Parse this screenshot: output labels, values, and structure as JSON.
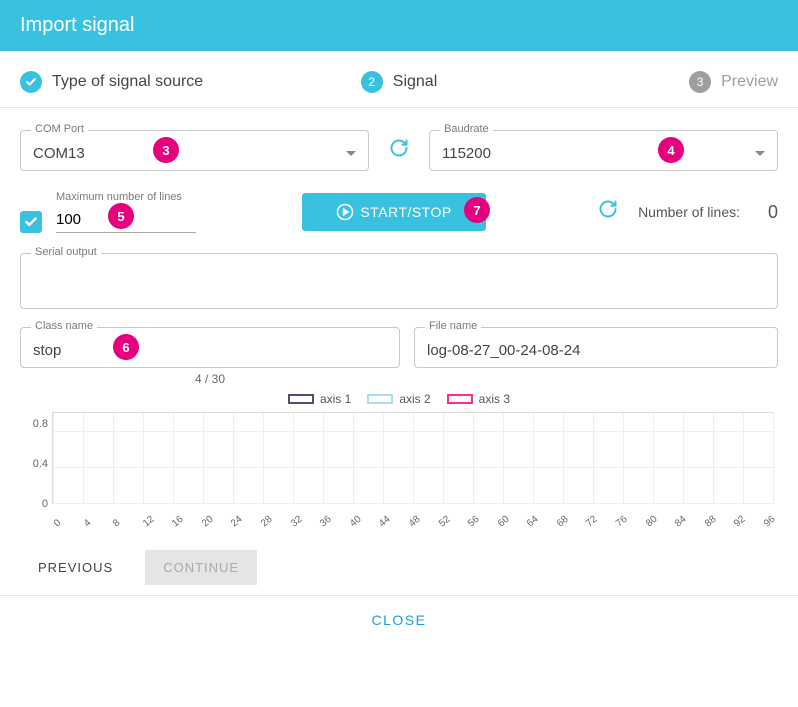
{
  "header": {
    "title": "Import signal"
  },
  "stepper": {
    "step1": {
      "label": "Type of signal source",
      "state": "done"
    },
    "step2": {
      "label": "Signal",
      "num": "2",
      "state": "active"
    },
    "step3": {
      "label": "Preview",
      "num": "3",
      "state": "future"
    }
  },
  "com_port": {
    "label": "COM Port",
    "value": "COM13"
  },
  "baudrate": {
    "label": "Baudrate",
    "value": "115200"
  },
  "max_lines": {
    "label": "Maximum number of lines",
    "value": "100"
  },
  "start_stop": {
    "label": "START/STOP"
  },
  "num_lines": {
    "label": "Number of lines:",
    "value": "0"
  },
  "serial_output": {
    "label": "Serial output"
  },
  "class_name": {
    "label": "Class name",
    "value": "stop",
    "counter": "4 / 30"
  },
  "file_name": {
    "label": "File name",
    "value": "log-08-27_00-24-08-24"
  },
  "chart_data": {
    "type": "line",
    "series": [
      {
        "name": "axis 1",
        "color": "#5a4a7a",
        "values": []
      },
      {
        "name": "axis 2",
        "color": "#a8dff2",
        "values": []
      },
      {
        "name": "axis 3",
        "color": "#ff2e88",
        "values": []
      }
    ],
    "x": [
      0,
      4,
      8,
      12,
      16,
      20,
      24,
      28,
      32,
      36,
      40,
      44,
      48,
      52,
      56,
      60,
      64,
      68,
      72,
      76,
      80,
      84,
      88,
      92,
      96
    ],
    "yticks": [
      0,
      0.4,
      0.8
    ],
    "ylim": [
      0,
      1
    ]
  },
  "buttons": {
    "previous": "PREVIOUS",
    "continue": "CONTINUE",
    "close": "CLOSE"
  },
  "annotation_badges": {
    "b3": "3",
    "b4": "4",
    "b5": "5",
    "b6": "6",
    "b7": "7"
  }
}
